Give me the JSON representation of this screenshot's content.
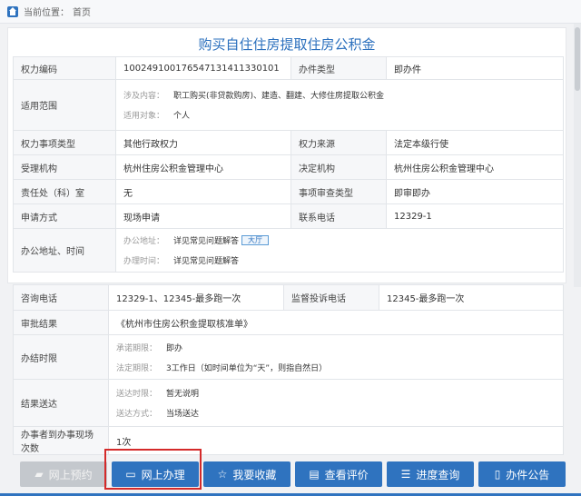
{
  "breadcrumb": {
    "label": "当前位置：",
    "page": "首页"
  },
  "title": "购买自住住房提取住房公积金",
  "table1": {
    "rows": [
      {
        "l1": "权力编码",
        "v1": "10024910017654713141133010​1",
        "l2": "办件类型",
        "v2": "即办件"
      },
      {
        "l1": "适用范围",
        "sub": [
          {
            "k": "涉及内容：",
            "v": "职工购买(非贷款购房)、建造、翻建、大修住房提取公积金"
          },
          {
            "k": "适用对象：",
            "v": "个人"
          }
        ]
      },
      {
        "l1": "权力事项类型",
        "v1": "其他行政权力",
        "l2": "权力来源",
        "v2": "法定本级行使"
      },
      {
        "l1": "受理机构",
        "v1": "杭州住房公积金管理中心",
        "l2": "决定机构",
        "v2": "杭州住房公积金管理中心"
      },
      {
        "l1": "责任处（科）室",
        "v1": "无",
        "l2": "事项审查类型",
        "v2": "即审即办"
      },
      {
        "l1": "申请方式",
        "v1": "现场申请",
        "l2": "联系电话",
        "v2": "12329-1"
      },
      {
        "l1": "办公地址、时间",
        "sub": [
          {
            "k": "办公地址：",
            "v": "详见常见问题解答",
            "icon": "大厅"
          },
          {
            "k": "办理时间：",
            "v": "详见常见问题解答"
          }
        ]
      }
    ]
  },
  "table2": {
    "rows": [
      {
        "l1": "咨询电话",
        "v1": "12329-1、12345-最多跑一次",
        "l2": "监督投诉电话",
        "v2": "12345-最多跑一次"
      },
      {
        "l1": "审批结果",
        "v1": "《杭州市住房公积金提取核准单》"
      },
      {
        "l1": "办结时限",
        "sub": [
          {
            "k": "承诺期限：",
            "v": "即办"
          },
          {
            "k": "法定期限：",
            "v": "3工作日（如时间单位为“天”，则指自然日）"
          }
        ]
      },
      {
        "l1": "结果送达",
        "sub": [
          {
            "k": "送达时限：",
            "v": "暂无说明"
          },
          {
            "k": "送达方式：",
            "v": "当场送达"
          }
        ]
      },
      {
        "l1": "办事者到办事现场次数",
        "v1": "1次"
      }
    ]
  },
  "buttons": {
    "online_booking": "网上预约",
    "online_handle": "网上办理",
    "favorite": "我要收藏",
    "review": "查看评价",
    "progress": "进度查询",
    "notice": "办件公告"
  }
}
